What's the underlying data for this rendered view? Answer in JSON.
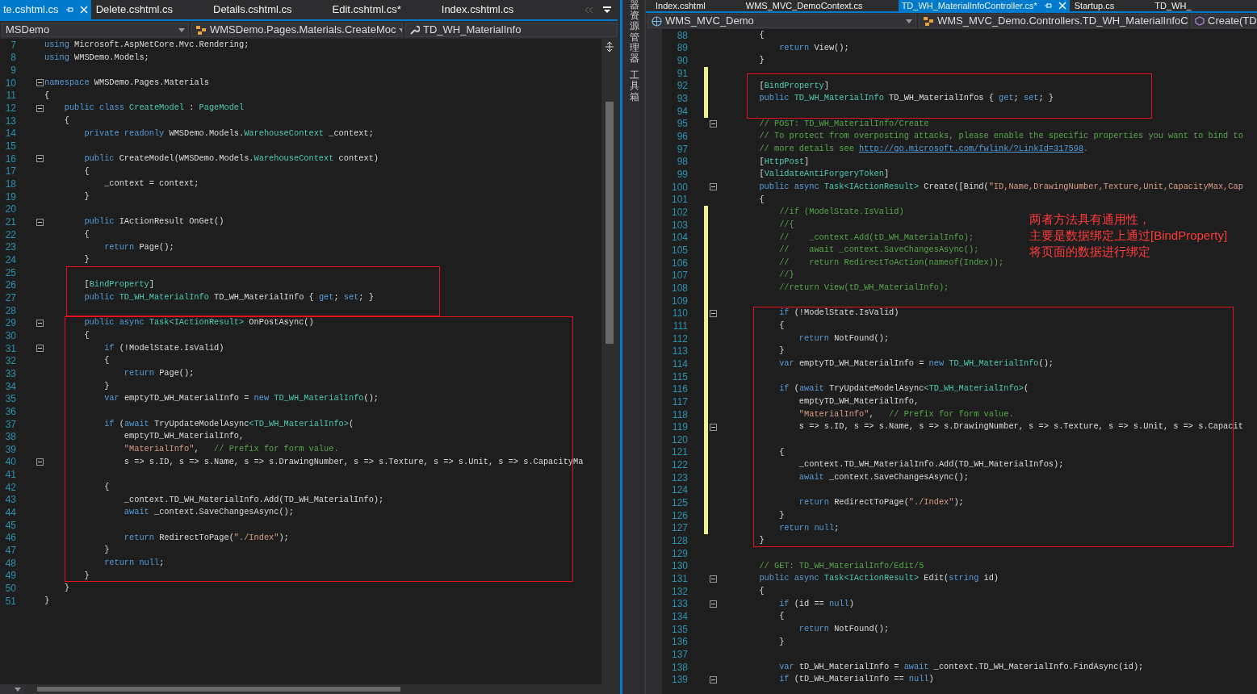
{
  "panes": [
    {
      "tabs": [
        {
          "label": "te.cshtml.cs",
          "selected": true
        },
        {
          "label": "Delete.cshtml.cs",
          "selected": false
        },
        {
          "label": "Details.cshtml.cs",
          "selected": false
        },
        {
          "label": "Edit.cshtml.cs*",
          "selected": false
        },
        {
          "label": "Index.cshtml.cs",
          "selected": false
        }
      ],
      "nav": [
        {
          "kind": "plain",
          "label": "MSDemo"
        },
        {
          "kind": "class",
          "label": "WMSDemo.Pages.Materials.CreateMoc"
        },
        {
          "kind": "member",
          "label": "TD_WH_MaterialInfo"
        }
      ],
      "blocks": [
        {
          "boxed": false,
          "lines": [
            {
              "n": "7",
              "fold": false,
              "code": [
                {
                  "kind": "kw",
                  "text": "using"
                },
                {
                  "kind": "pl",
                  "text": " Microsoft.AspNetCore.Mvc.Rendering;"
                }
              ]
            },
            {
              "n": "8",
              "fold": false,
              "code": [
                {
                  "kind": "kw",
                  "text": "using"
                },
                {
                  "kind": "pl",
                  "text": " WMSDemo.Models;"
                }
              ]
            },
            {
              "n": "9",
              "fold": false
            },
            {
              "n": "10",
              "fold": true,
              "code": [
                {
                  "kind": "kw",
                  "text": "namespace"
                },
                {
                  "kind": "pl",
                  "text": " WMSDemo.Pages.Materials"
                }
              ]
            },
            {
              "n": "11",
              "fold": false,
              "code": [
                {
                  "kind": "pl",
                  "text": "{"
                }
              ]
            },
            {
              "n": "12",
              "fold": true,
              "code": [
                {
                  "kind": "kw",
                  "text": "    public class "
                },
                {
                  "kind": "ty",
                  "text": "CreateModel"
                },
                {
                  "kind": "pl",
                  "text": " : "
                },
                {
                  "kind": "ty",
                  "text": "PageModel"
                }
              ]
            },
            {
              "n": "13",
              "fold": false,
              "code": [
                {
                  "kind": "pl",
                  "text": "    {"
                }
              ]
            },
            {
              "n": "14",
              "fold": false,
              "code": [
                {
                  "kind": "kw",
                  "text": "        private readonly "
                },
                {
                  "kind": "pl",
                  "text": "WMSDemo.Models."
                },
                {
                  "kind": "ty",
                  "text": "WarehouseContext"
                },
                {
                  "kind": "pl",
                  "text": " _context;"
                }
              ]
            },
            {
              "n": "15",
              "fold": false
            },
            {
              "n": "16",
              "fold": true,
              "code": [
                {
                  "kind": "kw",
                  "text": "        public "
                },
                {
                  "kind": "pl",
                  "text": "CreateModel(WMSDemo.Models."
                },
                {
                  "kind": "ty",
                  "text": "WarehouseContext"
                },
                {
                  "kind": "pl",
                  "text": " context)"
                }
              ]
            },
            {
              "n": "17",
              "fold": false,
              "code": [
                {
                  "kind": "pl",
                  "text": "        {"
                }
              ]
            },
            {
              "n": "18",
              "fold": false,
              "code": [
                {
                  "kind": "pl",
                  "text": "            _context = context;"
                }
              ]
            },
            {
              "n": "19",
              "fold": false,
              "code": [
                {
                  "kind": "pl",
                  "text": "        }"
                }
              ]
            },
            {
              "n": "20",
              "fold": false
            },
            {
              "n": "21",
              "fold": true,
              "code": [
                {
                  "kind": "kw",
                  "text": "        public "
                },
                {
                  "kind": "pl",
                  "text": "IActionResult OnGet()"
                }
              ]
            },
            {
              "n": "22",
              "fold": false,
              "code": [
                {
                  "kind": "pl",
                  "text": "        {"
                }
              ]
            },
            {
              "n": "23",
              "fold": false,
              "code": [
                {
                  "kind": "kw",
                  "text": "            return "
                },
                {
                  "kind": "pl",
                  "text": "Page();"
                }
              ]
            },
            {
              "n": "24",
              "fold": false,
              "code": [
                {
                  "kind": "pl",
                  "text": "        }"
                }
              ]
            }
          ]
        },
        {
          "boxed": true,
          "lines": [
            {
              "n": "25",
              "fold": false
            },
            {
              "n": "26",
              "fold": false,
              "code": [
                {
                  "kind": "pl",
                  "text": "        ["
                },
                {
                  "kind": "ty",
                  "text": "BindProperty"
                },
                {
                  "kind": "pl",
                  "text": "]"
                }
              ]
            },
            {
              "n": "27",
              "fold": false,
              "code": [
                {
                  "kind": "kw",
                  "text": "        public "
                },
                {
                  "kind": "ty",
                  "text": "TD_WH_MaterialInfo"
                },
                {
                  "kind": "pl",
                  "text": " TD_WH_MaterialInfo { "
                },
                {
                  "kind": "kw",
                  "text": "get"
                },
                {
                  "kind": "pl",
                  "text": "; "
                },
                {
                  "kind": "kw",
                  "text": "set"
                },
                {
                  "kind": "pl",
                  "text": "; }"
                }
              ]
            },
            {
              "n": "28",
              "fold": false
            }
          ]
        },
        {
          "boxed": true,
          "lines": [
            {
              "n": "29",
              "fold": true,
              "code": [
                {
                  "kind": "kw",
                  "text": "        public async "
                },
                {
                  "kind": "ty",
                  "text": "Task<IActionResult>"
                },
                {
                  "kind": "pl",
                  "text": " OnPostAsync()"
                }
              ]
            },
            {
              "n": "30",
              "fold": false,
              "code": [
                {
                  "kind": "pl",
                  "text": "        {"
                }
              ]
            },
            {
              "n": "31",
              "fold": true,
              "code": [
                {
                  "kind": "kw",
                  "text": "            if "
                },
                {
                  "kind": "pl",
                  "text": "(!ModelState.IsValid)"
                }
              ]
            },
            {
              "n": "32",
              "fold": false,
              "code": [
                {
                  "kind": "pl",
                  "text": "            {"
                }
              ]
            },
            {
              "n": "33",
              "fold": false,
              "code": [
                {
                  "kind": "kw",
                  "text": "                return "
                },
                {
                  "kind": "pl",
                  "text": "Page();"
                }
              ]
            },
            {
              "n": "34",
              "fold": false,
              "code": [
                {
                  "kind": "pl",
                  "text": "            }"
                }
              ]
            },
            {
              "n": "35",
              "fold": false,
              "code": [
                {
                  "kind": "kw",
                  "text": "            var "
                },
                {
                  "kind": "pl",
                  "text": "emptyTD_WH_MaterialInfo = "
                },
                {
                  "kind": "kw",
                  "text": "new "
                },
                {
                  "kind": "ty",
                  "text": "TD_WH_MaterialInfo"
                },
                {
                  "kind": "pl",
                  "text": "();"
                }
              ]
            },
            {
              "n": "36",
              "fold": false
            },
            {
              "n": "37",
              "fold": false,
              "code": [
                {
                  "kind": "kw",
                  "text": "            if "
                },
                {
                  "kind": "pl",
                  "text": "("
                },
                {
                  "kind": "kw",
                  "text": "await "
                },
                {
                  "kind": "pl",
                  "text": "TryUpdateModelAsync"
                },
                {
                  "kind": "ty",
                  "text": "<TD_WH_MaterialInfo>"
                },
                {
                  "kind": "pl",
                  "text": "("
                }
              ]
            },
            {
              "n": "38",
              "fold": false,
              "code": [
                {
                  "kind": "pl",
                  "text": "                emptyTD_WH_MaterialInfo,"
                }
              ]
            },
            {
              "n": "39",
              "fold": false,
              "code": [
                {
                  "kind": "st",
                  "text": "                \"MaterialInfo\""
                },
                {
                  "kind": "pl",
                  "text": ",   "
                },
                {
                  "kind": "cm",
                  "text": "// Prefix for form value."
                }
              ]
            },
            {
              "n": "40",
              "fold": true,
              "code": [
                {
                  "kind": "pl",
                  "text": "                s => s.ID, s => s.Name, s => s.DrawingNumber, s => s.Texture, s => s.Unit, s => s.CapacityMa"
                }
              ]
            },
            {
              "n": "41",
              "fold": false
            },
            {
              "n": "42",
              "fold": false,
              "code": [
                {
                  "kind": "pl",
                  "text": "            {"
                }
              ]
            },
            {
              "n": "43",
              "fold": false,
              "code": [
                {
                  "kind": "pl",
                  "text": "                _context.TD_WH_MaterialInfo.Add(TD_WH_MaterialInfo);"
                }
              ]
            },
            {
              "n": "44",
              "fold": false,
              "code": [
                {
                  "kind": "kw",
                  "text": "                await "
                },
                {
                  "kind": "pl",
                  "text": "_context.SaveChangesAsync();"
                }
              ]
            },
            {
              "n": "45",
              "fold": false
            },
            {
              "n": "46",
              "fold": false,
              "code": [
                {
                  "kind": "kw",
                  "text": "                return "
                },
                {
                  "kind": "pl",
                  "text": "RedirectToPage("
                },
                {
                  "kind": "st",
                  "text": "\"./Index\""
                },
                {
                  "kind": "pl",
                  "text": ");"
                }
              ]
            },
            {
              "n": "47",
              "fold": false,
              "code": [
                {
                  "kind": "pl",
                  "text": "            }"
                }
              ]
            },
            {
              "n": "48",
              "fold": false,
              "code": [
                {
                  "kind": "kw",
                  "text": "            return null"
                },
                {
                  "kind": "pl",
                  "text": ";"
                }
              ]
            },
            {
              "n": "49",
              "fold": false,
              "code": [
                {
                  "kind": "pl",
                  "text": "        }"
                }
              ]
            }
          ]
        },
        {
          "boxed": false,
          "lines": [
            {
              "n": "50",
              "fold": false,
              "code": [
                {
                  "kind": "pl",
                  "text": "    }"
                }
              ]
            },
            {
              "n": "51",
              "fold": false,
              "code": [
                {
                  "kind": "pl",
                  "text": "}"
                }
              ]
            }
          ]
        }
      ]
    },
    {
      "tabs": [
        {
          "label": "Index.cshtml",
          "selected": false
        },
        {
          "label": "WMS_MVC_DemoContext.cs",
          "selected": false
        },
        {
          "label": "TD_WH_MaterialInfoController.cs*",
          "selected": true
        },
        {
          "label": "Startup.cs",
          "selected": false
        },
        {
          "label": "TD_WH_",
          "selected": false
        }
      ],
      "nav": [
        {
          "kind": "project",
          "label": "WMS_MVC_Demo"
        },
        {
          "kind": "class",
          "label": "WMS_MVC_Demo.Controllers.TD_WH_MaterialInfoC"
        },
        {
          "kind": "method",
          "label": "Create(TD"
        }
      ],
      "note": {
        "lines": [
          "两者方法具有通用性，",
          "主要是数据绑定上通过[BindProperty]",
          "将页面的数据进行绑定"
        ]
      },
      "blocks": [
        {
          "boxed": false,
          "lines": [
            {
              "n": "88",
              "fold": false,
              "changed": false,
              "code": [
                {
                  "kind": "pl",
                  "text": "        {"
                }
              ]
            },
            {
              "n": "89",
              "fold": false,
              "changed": false,
              "code": [
                {
                  "kind": "kw",
                  "text": "            return "
                },
                {
                  "kind": "pl",
                  "text": "View();"
                }
              ]
            },
            {
              "n": "90",
              "fold": false,
              "changed": false,
              "code": [
                {
                  "kind": "pl",
                  "text": "        }"
                }
              ]
            }
          ]
        },
        {
          "boxed": true,
          "lines": [
            {
              "n": "91",
              "fold": false,
              "changed": true
            },
            {
              "n": "92",
              "fold": false,
              "changed": true,
              "code": [
                {
                  "kind": "pl",
                  "text": "        ["
                },
                {
                  "kind": "ty",
                  "text": "BindProperty"
                },
                {
                  "kind": "pl",
                  "text": "]"
                }
              ]
            },
            {
              "n": "93",
              "fold": false,
              "changed": true,
              "code": [
                {
                  "kind": "kw",
                  "text": "        public "
                },
                {
                  "kind": "ty",
                  "text": "TD_WH_MaterialInfo"
                },
                {
                  "kind": "pl",
                  "text": " TD_WH_MaterialInfos { "
                },
                {
                  "kind": "kw",
                  "text": "get"
                },
                {
                  "kind": "pl",
                  "text": "; "
                },
                {
                  "kind": "kw",
                  "text": "set"
                },
                {
                  "kind": "pl",
                  "text": "; }"
                }
              ]
            },
            {
              "n": "94",
              "fold": false,
              "changed": true
            }
          ]
        },
        {
          "boxed": false,
          "lines": [
            {
              "n": "95",
              "fold": true,
              "changed": false,
              "code": [
                {
                  "kind": "cm",
                  "text": "        // POST: TD_WH_MaterialInfo/Create"
                }
              ]
            },
            {
              "n": "96",
              "fold": false,
              "changed": false,
              "code": [
                {
                  "kind": "cm",
                  "text": "        // To protect from overposting attacks, please enable the specific properties you want to bind to"
                }
              ]
            },
            {
              "n": "97",
              "fold": false,
              "changed": false,
              "code": [
                {
                  "kind": "cm",
                  "text": "        // more details see "
                },
                {
                  "kind": "ln",
                  "text": "http://go.microsoft.com/fwlink/?LinkId=317598"
                },
                {
                  "kind": "cm",
                  "text": "."
                }
              ]
            },
            {
              "n": "98",
              "fold": false,
              "changed": false,
              "code": [
                {
                  "kind": "pl",
                  "text": "        ["
                },
                {
                  "kind": "ty",
                  "text": "HttpPost"
                },
                {
                  "kind": "pl",
                  "text": "]"
                }
              ]
            },
            {
              "n": "99",
              "fold": false,
              "changed": false,
              "code": [
                {
                  "kind": "pl",
                  "text": "        ["
                },
                {
                  "kind": "ty",
                  "text": "ValidateAntiForgeryToken"
                },
                {
                  "kind": "pl",
                  "text": "]"
                }
              ]
            },
            {
              "n": "100",
              "fold": true,
              "changed": false,
              "code": [
                {
                  "kind": "kw",
                  "text": "        public async "
                },
                {
                  "kind": "ty",
                  "text": "Task<IActionResult>"
                },
                {
                  "kind": "pl",
                  "text": " Create([Bind("
                },
                {
                  "kind": "st",
                  "text": "\"ID,Name,DrawingNumber,Texture,Unit,CapacityMax,Cap"
                }
              ]
            },
            {
              "n": "101",
              "fold": false,
              "changed": false,
              "code": [
                {
                  "kind": "pl",
                  "text": "        {"
                }
              ]
            },
            {
              "n": "102",
              "fold": false,
              "changed": true,
              "code": [
                {
                  "kind": "cm",
                  "text": "            //if (ModelState.IsValid)"
                }
              ]
            },
            {
              "n": "103",
              "fold": false,
              "changed": true,
              "code": [
                {
                  "kind": "cm",
                  "text": "            //{"
                }
              ]
            },
            {
              "n": "104",
              "fold": false,
              "changed": true,
              "code": [
                {
                  "kind": "cm",
                  "text": "            //    _context.Add(tD_WH_MaterialInfo);"
                }
              ]
            },
            {
              "n": "105",
              "fold": false,
              "changed": true,
              "code": [
                {
                  "kind": "cm",
                  "text": "            //    await _context.SaveChangesAsync();"
                }
              ]
            },
            {
              "n": "106",
              "fold": false,
              "changed": true,
              "code": [
                {
                  "kind": "cm",
                  "text": "            //    return RedirectToAction(nameof(Index));"
                }
              ]
            },
            {
              "n": "107",
              "fold": false,
              "changed": true,
              "code": [
                {
                  "kind": "cm",
                  "text": "            //}"
                }
              ]
            },
            {
              "n": "108",
              "fold": false,
              "changed": true,
              "code": [
                {
                  "kind": "cm",
                  "text": "            //return View(tD_WH_MaterialInfo);"
                }
              ]
            },
            {
              "n": "109",
              "fold": false,
              "changed": true
            }
          ]
        },
        {
          "boxed": true,
          "lines": [
            {
              "n": "110",
              "fold": true,
              "changed": true,
              "code": [
                {
                  "kind": "kw",
                  "text": "            if "
                },
                {
                  "kind": "pl",
                  "text": "(!ModelState.IsValid)"
                }
              ]
            },
            {
              "n": "111",
              "fold": false,
              "changed": true,
              "code": [
                {
                  "kind": "pl",
                  "text": "            {"
                }
              ]
            },
            {
              "n": "112",
              "fold": false,
              "changed": true,
              "code": [
                {
                  "kind": "kw",
                  "text": "                return "
                },
                {
                  "kind": "pl",
                  "text": "NotFound();"
                }
              ]
            },
            {
              "n": "113",
              "fold": false,
              "changed": true,
              "code": [
                {
                  "kind": "pl",
                  "text": "            }"
                }
              ]
            },
            {
              "n": "114",
              "fold": false,
              "changed": true,
              "code": [
                {
                  "kind": "kw",
                  "text": "            var "
                },
                {
                  "kind": "pl",
                  "text": "emptyTD_WH_MaterialInfo = "
                },
                {
                  "kind": "kw",
                  "text": "new "
                },
                {
                  "kind": "ty",
                  "text": "TD_WH_MaterialInfo"
                },
                {
                  "kind": "pl",
                  "text": "();"
                }
              ]
            },
            {
              "n": "115",
              "fold": false,
              "changed": true
            },
            {
              "n": "116",
              "fold": false,
              "changed": true,
              "code": [
                {
                  "kind": "kw",
                  "text": "            if "
                },
                {
                  "kind": "pl",
                  "text": "("
                },
                {
                  "kind": "kw",
                  "text": "await "
                },
                {
                  "kind": "pl",
                  "text": "TryUpdateModelAsync"
                },
                {
                  "kind": "ty",
                  "text": "<TD_WH_MaterialInfo>"
                },
                {
                  "kind": "pl",
                  "text": "("
                }
              ]
            },
            {
              "n": "117",
              "fold": false,
              "changed": true,
              "code": [
                {
                  "kind": "pl",
                  "text": "                emptyTD_WH_MaterialInfo,"
                }
              ]
            },
            {
              "n": "118",
              "fold": false,
              "changed": true,
              "code": [
                {
                  "kind": "st",
                  "text": "                \"MaterialInfo\""
                },
                {
                  "kind": "pl",
                  "text": ",   "
                },
                {
                  "kind": "cm",
                  "text": "// Prefix for form value."
                }
              ]
            },
            {
              "n": "119",
              "fold": true,
              "changed": true,
              "code": [
                {
                  "kind": "pl",
                  "text": "                s => s.ID, s => s.Name, s => s.DrawingNumber, s => s.Texture, s => s.Unit, s => s.Capacit"
                }
              ]
            },
            {
              "n": "120",
              "fold": false,
              "changed": true
            },
            {
              "n": "121",
              "fold": false,
              "changed": true,
              "code": [
                {
                  "kind": "pl",
                  "text": "            {"
                }
              ]
            },
            {
              "n": "122",
              "fold": false,
              "changed": true,
              "code": [
                {
                  "kind": "pl",
                  "text": "                _context.TD_WH_MaterialInfo.Add(TD_WH_MaterialInfos);"
                }
              ]
            },
            {
              "n": "123",
              "fold": false,
              "changed": true,
              "code": [
                {
                  "kind": "kw",
                  "text": "                await "
                },
                {
                  "kind": "pl",
                  "text": "_context.SaveChangesAsync();"
                }
              ]
            },
            {
              "n": "124",
              "fold": false,
              "changed": true
            },
            {
              "n": "125",
              "fold": false,
              "changed": true,
              "code": [
                {
                  "kind": "kw",
                  "text": "                return "
                },
                {
                  "kind": "pl",
                  "text": "RedirectToPage("
                },
                {
                  "kind": "st",
                  "text": "\"./Index\""
                },
                {
                  "kind": "pl",
                  "text": ");"
                }
              ]
            },
            {
              "n": "126",
              "fold": false,
              "changed": true,
              "code": [
                {
                  "kind": "pl",
                  "text": "            }"
                }
              ]
            },
            {
              "n": "127",
              "fold": false,
              "changed": true,
              "code": [
                {
                  "kind": "kw",
                  "text": "            return null"
                },
                {
                  "kind": "pl",
                  "text": ";"
                }
              ]
            },
            {
              "n": "128",
              "fold": false,
              "changed": false,
              "code": [
                {
                  "kind": "pl",
                  "text": "        }"
                }
              ]
            }
          ]
        },
        {
          "boxed": false,
          "lines": [
            {
              "n": "129",
              "fold": false,
              "changed": false
            },
            {
              "n": "130",
              "fold": false,
              "changed": false,
              "code": [
                {
                  "kind": "cm",
                  "text": "        // GET: TD_WH_MaterialInfo/Edit/5"
                }
              ]
            },
            {
              "n": "131",
              "fold": true,
              "changed": false,
              "code": [
                {
                  "kind": "kw",
                  "text": "        public async "
                },
                {
                  "kind": "ty",
                  "text": "Task<IActionResult>"
                },
                {
                  "kind": "pl",
                  "text": " Edit("
                },
                {
                  "kind": "kw",
                  "text": "string"
                },
                {
                  "kind": "pl",
                  "text": " id)"
                }
              ]
            },
            {
              "n": "132",
              "fold": false,
              "changed": false,
              "code": [
                {
                  "kind": "pl",
                  "text": "        {"
                }
              ]
            },
            {
              "n": "133",
              "fold": true,
              "changed": false,
              "code": [
                {
                  "kind": "kw",
                  "text": "            if "
                },
                {
                  "kind": "pl",
                  "text": "(id == "
                },
                {
                  "kind": "kw",
                  "text": "null"
                },
                {
                  "kind": "pl",
                  "text": ")"
                }
              ]
            },
            {
              "n": "134",
              "fold": false,
              "changed": false,
              "code": [
                {
                  "kind": "pl",
                  "text": "            {"
                }
              ]
            },
            {
              "n": "135",
              "fold": false,
              "changed": false,
              "code": [
                {
                  "kind": "kw",
                  "text": "                return "
                },
                {
                  "kind": "pl",
                  "text": "NotFound();"
                }
              ]
            },
            {
              "n": "136",
              "fold": false,
              "changed": false,
              "code": [
                {
                  "kind": "pl",
                  "text": "            }"
                }
              ]
            },
            {
              "n": "137",
              "fold": false,
              "changed": false
            },
            {
              "n": "138",
              "fold": false,
              "changed": false,
              "code": [
                {
                  "kind": "kw",
                  "text": "            var "
                },
                {
                  "kind": "pl",
                  "text": "tD_WH_MaterialInfo = "
                },
                {
                  "kind": "kw",
                  "text": "await "
                },
                {
                  "kind": "pl",
                  "text": "_context.TD_WH_MaterialInfo.FindAsync(id);"
                }
              ]
            },
            {
              "n": "139",
              "fold": true,
              "changed": false,
              "code": [
                {
                  "kind": "kw",
                  "text": "            if "
                },
                {
                  "kind": "pl",
                  "text": "(tD_WH_MaterialInfo == "
                },
                {
                  "kind": "kw",
                  "text": "null"
                },
                {
                  "kind": "pl",
                  "text": ")"
                }
              ]
            }
          ]
        }
      ]
    }
  ],
  "tool_strip": [
    {
      "label": "器资源管理器"
    },
    {
      "label": "工具箱"
    }
  ]
}
